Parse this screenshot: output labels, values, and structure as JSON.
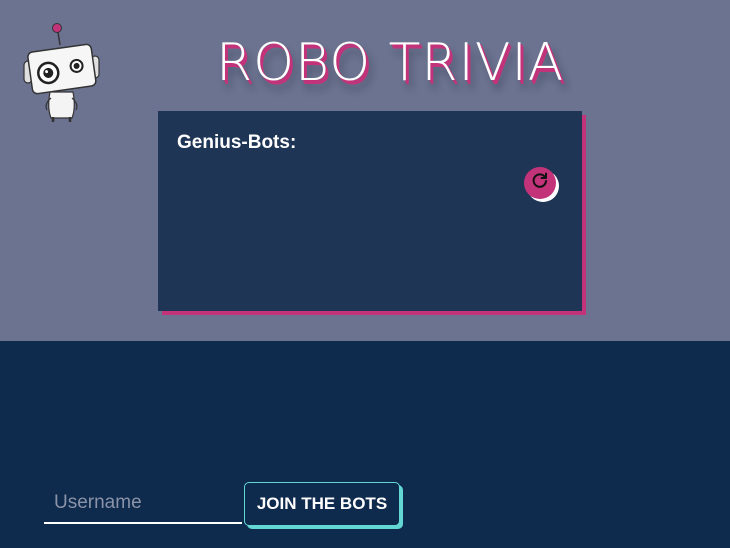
{
  "app": {
    "title": "ROBO TRIVIA",
    "logo_icon": "robot-mascot-icon"
  },
  "leaderboard": {
    "title": "Genius-Bots:",
    "refresh_icon": "refresh-icon",
    "entries": []
  },
  "join_form": {
    "username_placeholder": "Username",
    "username_value": "",
    "join_label": "JOIN THE BOTS"
  },
  "colors": {
    "top_background": "#6b7390",
    "bottom_background": "#0e2a4d",
    "panel_background": "#1f3556",
    "accent_pink": "#c2337a",
    "accent_teal": "#63d7d4",
    "text_white": "#ffffff"
  }
}
